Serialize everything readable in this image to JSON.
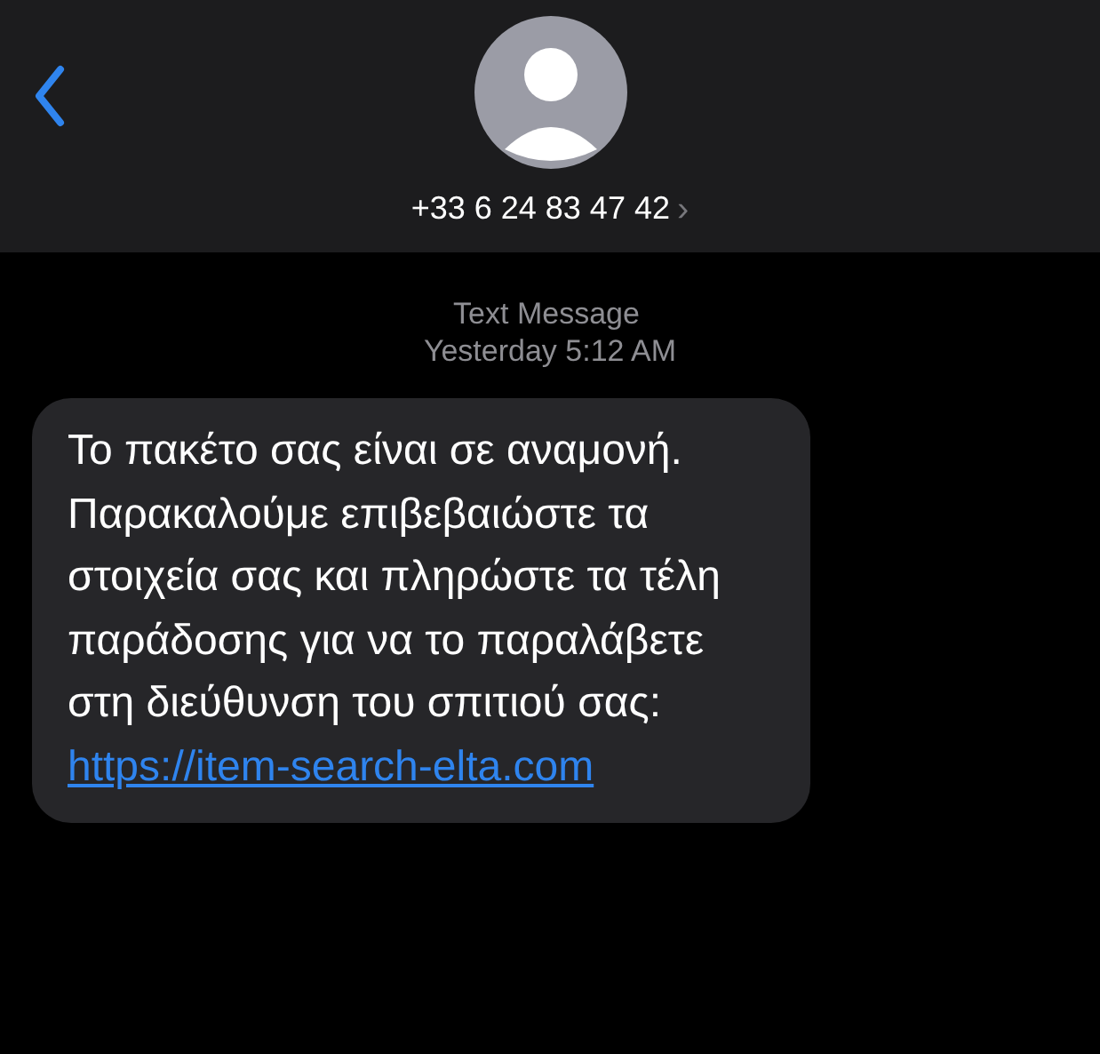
{
  "header": {
    "contact": "+33 6 24 83 47 42",
    "chevron": "›"
  },
  "meta": {
    "service": "Text Message",
    "timestamp": "Yesterday 5:12 AM"
  },
  "messages": [
    {
      "kind": "incoming",
      "text": "Το πακέτο σας είναι σε αναμονή. Παρακαλούμε επιβεβαιώστε τα στοιχεία σας και πληρώστε τα τέλη παράδοσης για να το παραλάβετε στη διεύθυνση του σπιτιού σας:",
      "link": "https://item-search-elta.com"
    }
  ]
}
